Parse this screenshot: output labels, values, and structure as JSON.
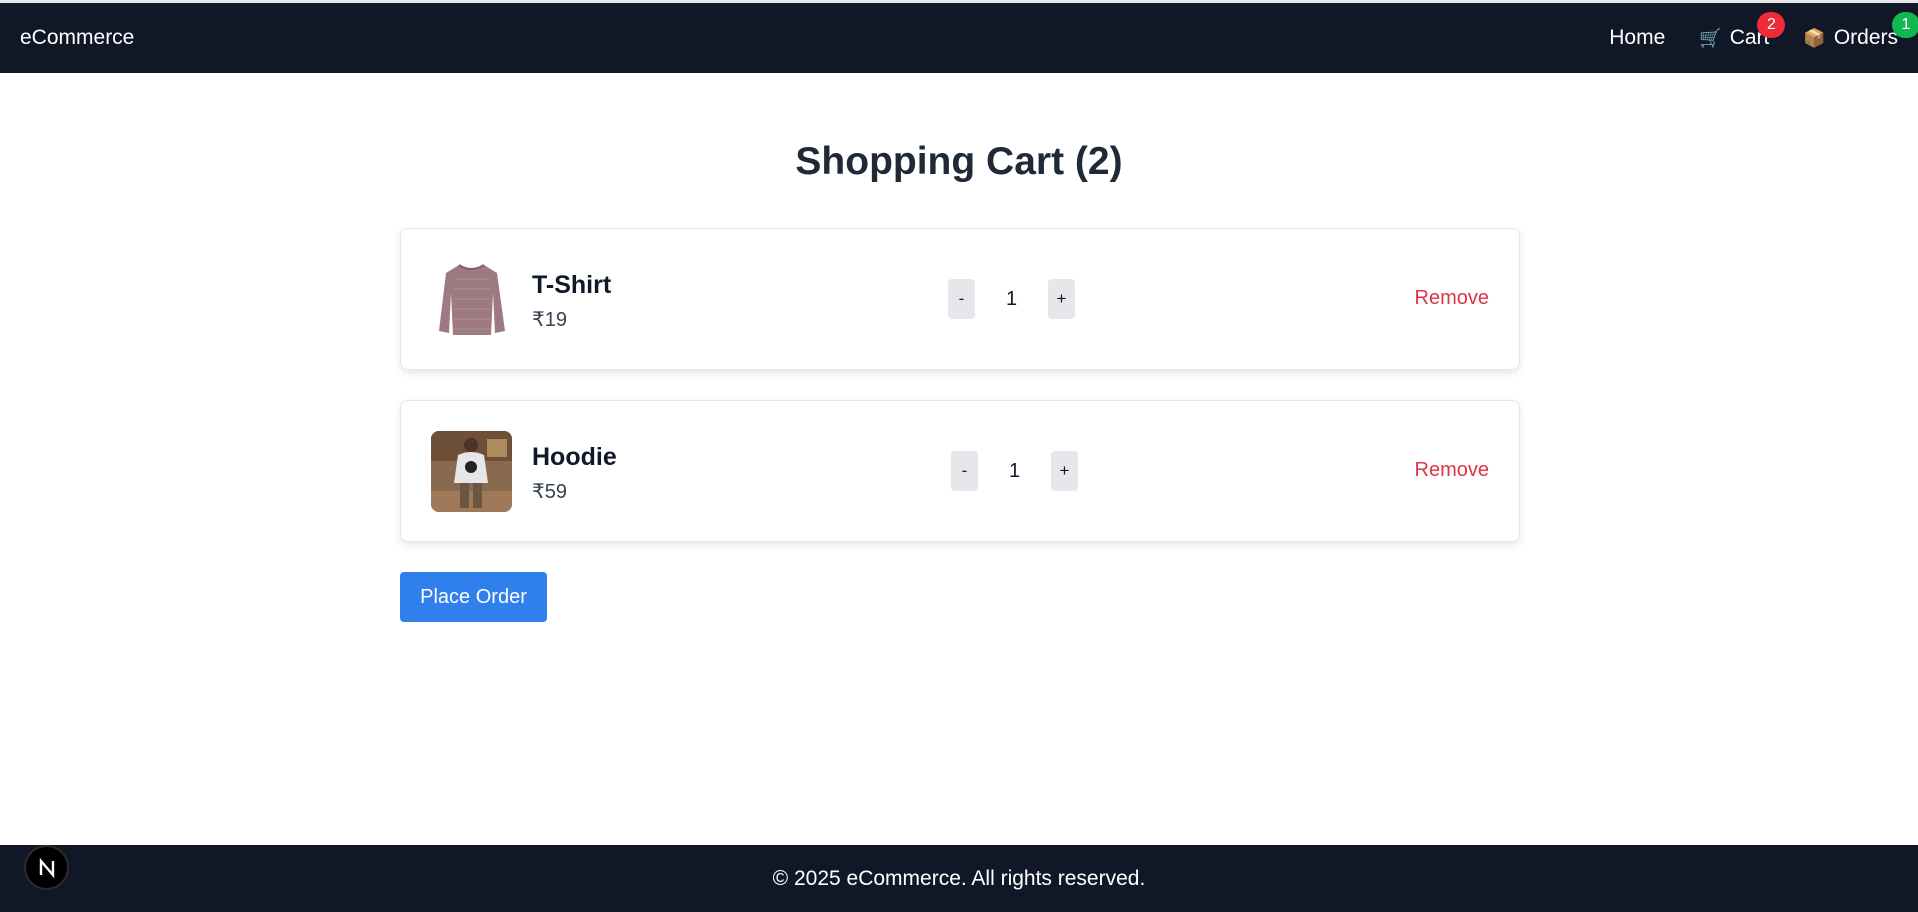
{
  "header": {
    "brand": "eCommerce",
    "nav": {
      "home": "Home",
      "cart": {
        "icon": "shopping-cart-icon",
        "label": "Cart",
        "badge": "2"
      },
      "orders": {
        "icon": "package-icon",
        "label": "Orders",
        "badge": "1"
      }
    }
  },
  "cart": {
    "title": "Shopping Cart (2)",
    "items": [
      {
        "name": "T-Shirt",
        "price": "₹19",
        "quantity": "1",
        "decrement": "-",
        "increment": "+",
        "remove": "Remove",
        "image": "sweater-image"
      },
      {
        "name": "Hoodie",
        "price": "₹59",
        "quantity": "1",
        "decrement": "-",
        "increment": "+",
        "remove": "Remove",
        "image": "hoodie-model-image"
      }
    ],
    "place_order": "Place Order"
  },
  "footer": {
    "copyright": "© 2025 eCommerce. All rights reserved."
  },
  "colors": {
    "nav_bg": "#101828",
    "cart_badge": "#ef2b3a",
    "orders_badge": "#12b84f",
    "remove_text": "#dc3545",
    "primary_button": "#2f80ed"
  }
}
